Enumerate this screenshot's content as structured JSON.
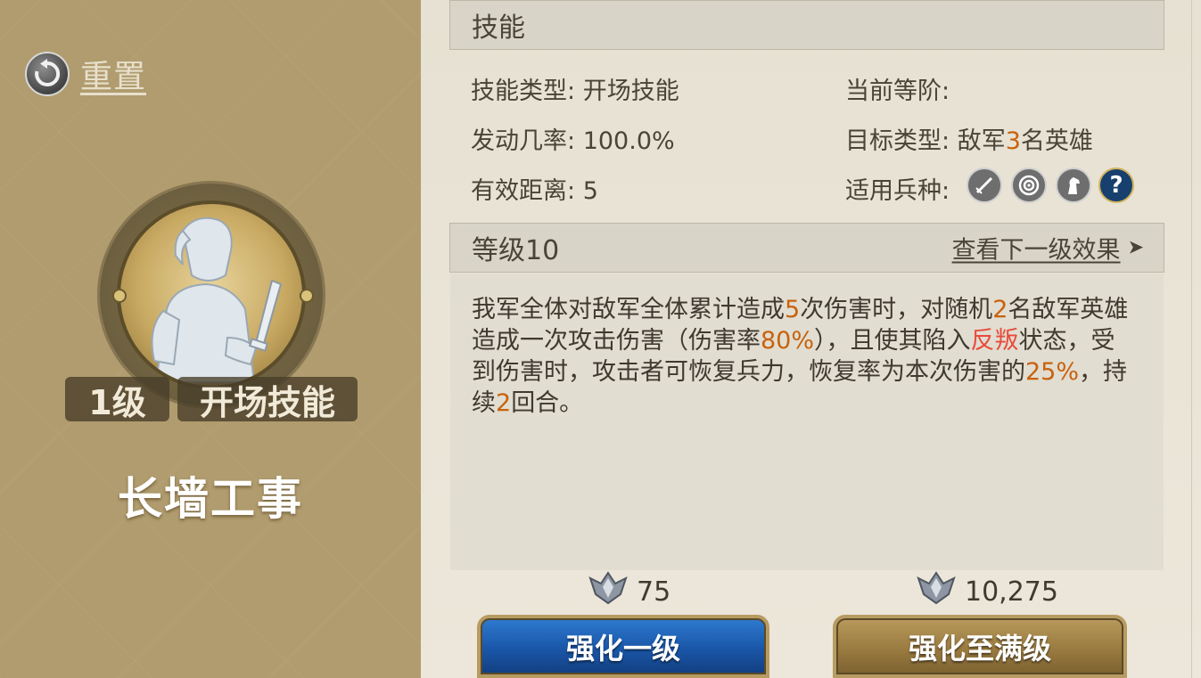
{
  "left_panel": {
    "reset_label": "重置",
    "level_tag": "1级",
    "type_tag": "开场技能",
    "skill_name": "长墙工事"
  },
  "skill_section": {
    "title": "技能",
    "type_label": "技能类型:",
    "type_value": "开场技能",
    "rank_label": "当前等阶:",
    "rank_value": "",
    "chance_label": "发动几率:",
    "chance_value": "100.0%",
    "target_label": "目标类型:",
    "target_prefix": "敌军",
    "target_count": "3",
    "target_suffix": "名英雄",
    "range_label": "有效距离:",
    "range_value": "5",
    "troop_label": "适用兵种:",
    "troop_icons": [
      "sword-icon",
      "target-icon",
      "horse-icon",
      "question-icon"
    ]
  },
  "level_section": {
    "title": "等级10",
    "next_link": "查看下一级效果",
    "next_arrow": "➤"
  },
  "description": {
    "p1": "我军全体对敌军全体累计造成",
    "n1": "5",
    "p2": "次伤害时，对随机",
    "n2": "2",
    "p3": "名敌军英雄造成一次攻击伤害（伤害率",
    "n3": "80%",
    "p4": "），且使其陷入",
    "status": "反叛",
    "p5": "状态，受到伤害时，攻击者可恢复兵力，恢复率为本次伤害的",
    "n4": "25%",
    "p6": "，持续",
    "n5": "2",
    "p7": "回合。"
  },
  "upgrade": {
    "cost_one": "75",
    "cost_max": "10,275",
    "btn_one": "强化一级",
    "btn_max": "强化至满级"
  },
  "colors": {
    "highlight": "#c8620d",
    "status_red": "#e84c3d",
    "button_blue": "#1a56a8",
    "button_gold": "#9a7b40"
  }
}
